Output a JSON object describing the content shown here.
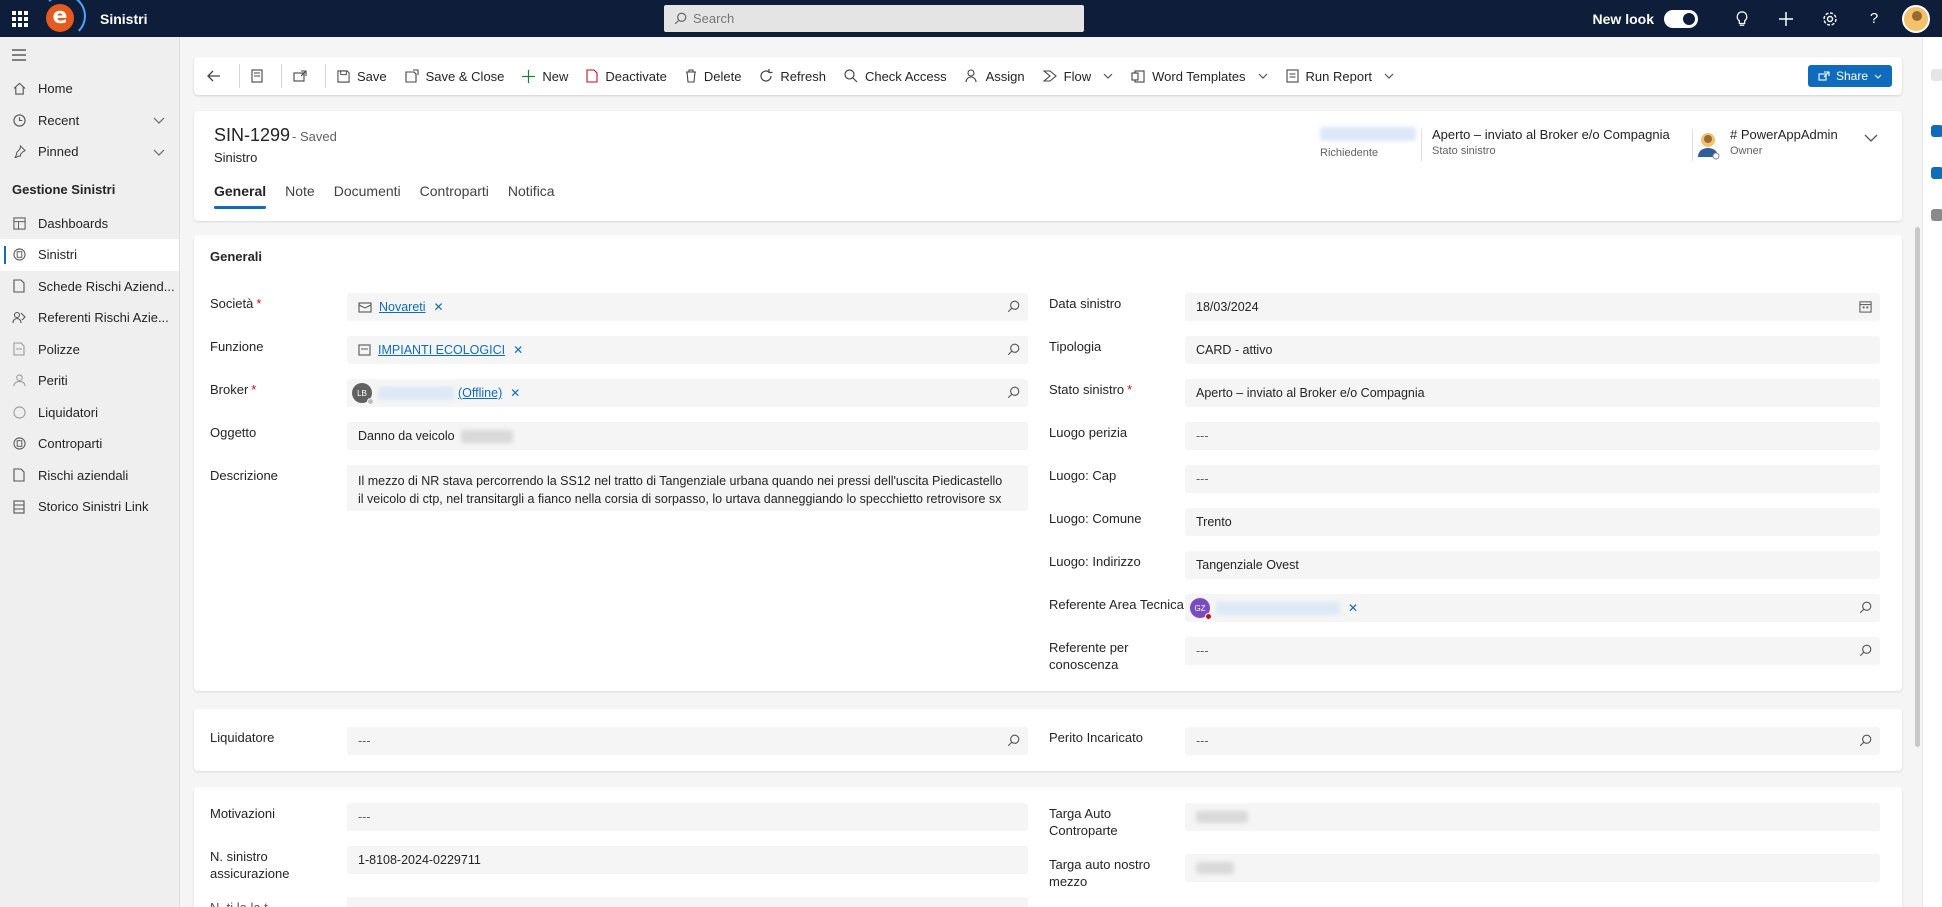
{
  "topbar": {
    "app_name": "Sinistri",
    "logo_letter": "e",
    "search_placeholder": "Search",
    "new_look_label": "New look"
  },
  "sidebar": {
    "items_top": [
      {
        "label": "Home",
        "icon": "home-icon"
      },
      {
        "label": "Recent",
        "icon": "clock-icon",
        "chevron": true
      },
      {
        "label": "Pinned",
        "icon": "pin-icon",
        "chevron": true
      }
    ],
    "section_title": "Gestione Sinistri",
    "items": [
      {
        "label": "Dashboards",
        "icon": "dashboard-icon"
      },
      {
        "label": "Sinistri",
        "icon": "entity-icon",
        "active": true
      },
      {
        "label": "Schede Rischi Aziend...",
        "icon": "document-icon"
      },
      {
        "label": "Referenti Rischi Azie...",
        "icon": "people-icon"
      },
      {
        "label": "Polizze",
        "icon": "policy-icon"
      },
      {
        "label": "Periti",
        "icon": "person-icon"
      },
      {
        "label": "Liquidatori",
        "icon": "circle-icon"
      },
      {
        "label": "Controparti",
        "icon": "entity-icon"
      },
      {
        "label": "Rischi aziendali",
        "icon": "document-icon"
      },
      {
        "label": "Storico Sinistri Link",
        "icon": "table-icon"
      }
    ]
  },
  "commands": {
    "save": "Save",
    "save_close": "Save & Close",
    "new": "New",
    "deactivate": "Deactivate",
    "delete": "Delete",
    "refresh": "Refresh",
    "check_access": "Check Access",
    "assign": "Assign",
    "flow": "Flow",
    "word_templates": "Word Templates",
    "run_report": "Run Report",
    "share": "Share"
  },
  "header": {
    "record_id": "SIN-1299",
    "saved_status": "- Saved",
    "entity": "Sinistro",
    "richiedente_label": "Richiedente",
    "stato_value": "Aperto – inviato al Broker e/o Compagnia",
    "stato_label": "Stato sinistro",
    "owner_value": "# PowerAppAdmin",
    "owner_label": "Owner"
  },
  "tabs": [
    "General",
    "Note",
    "Documenti",
    "Controparti",
    "Notifica"
  ],
  "generali": {
    "title": "Generali",
    "societa_label": "Società",
    "societa_value": "Novareti",
    "funzione_label": "Funzione",
    "funzione_value": "IMPIANTI ECOLOGICI",
    "broker_label": "Broker",
    "broker_initials": "LB",
    "broker_suffix": "(Offline)",
    "oggetto_label": "Oggetto",
    "oggetto_value": "Danno da veicolo",
    "descrizione_label": "Descrizione",
    "descrizione_value": "Il mezzo di NR stava percorrendo la SS12 nel tratto di Tangenziale urbana quando nei pressi dell'uscita Piedicastello il veicolo di ctp, nel transitargli a fianco nella corsia di sorpasso, lo urtava danneggiando lo specchietto retrovisore sx",
    "data_label": "Data sinistro",
    "data_value": "18/03/2024",
    "tipologia_label": "Tipologia",
    "tipologia_value": "CARD - attivo",
    "stato_label": "Stato sinistro",
    "stato_value": "Aperto – inviato al Broker e/o Compagnia",
    "luogo_perizia_label": "Luogo perizia",
    "luogo_cap_label": "Luogo: Cap",
    "luogo_comune_label": "Luogo: Comune",
    "luogo_comune_value": "Trento",
    "luogo_indirizzo_label": "Luogo: Indirizzo",
    "luogo_indirizzo_value": "Tangenziale Ovest",
    "referente_label": "Referente Area Tecnica",
    "referente_initials": "GZ",
    "referente_conoscenza_label_1": "Referente per",
    "referente_conoscenza_label_2": "conoscenza",
    "empty": "---"
  },
  "liquidazione": {
    "liquidatore_label": "Liquidatore",
    "perito_label": "Perito Incaricato",
    "empty": "---"
  },
  "altri": {
    "motivazioni_label": "Motivazioni",
    "n_sinistro_label_1": "N. sinistro",
    "n_sinistro_label_2": "assicurazione",
    "n_sinistro_value": "1-8108-2024-0229711",
    "targa_ctp_label_1": "Targa Auto",
    "targa_ctp_label_2": "Controparte",
    "targa_nostro_label_1": "Targa auto nostro",
    "targa_nostro_label_2": "mezzo",
    "next_label_partial": "N. ti la la t",
    "empty": "---"
  },
  "colors": {
    "topbar": "#0d1d3a",
    "accent": "#0f6cbd",
    "required": "#c50f1f"
  }
}
